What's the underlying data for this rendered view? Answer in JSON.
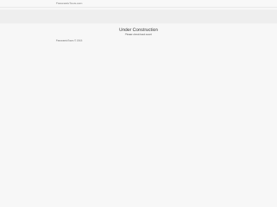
{
  "header": {
    "site_name": "PanoramicTours.com"
  },
  "main": {
    "heading": "Under Construction",
    "subtext": "Please check back soon!"
  },
  "footer": {
    "copyright": "PanoramicTours © 2015"
  },
  "colors": {
    "background": "#f7f7f7",
    "banner": "#eeeeee",
    "text": "#333333"
  }
}
